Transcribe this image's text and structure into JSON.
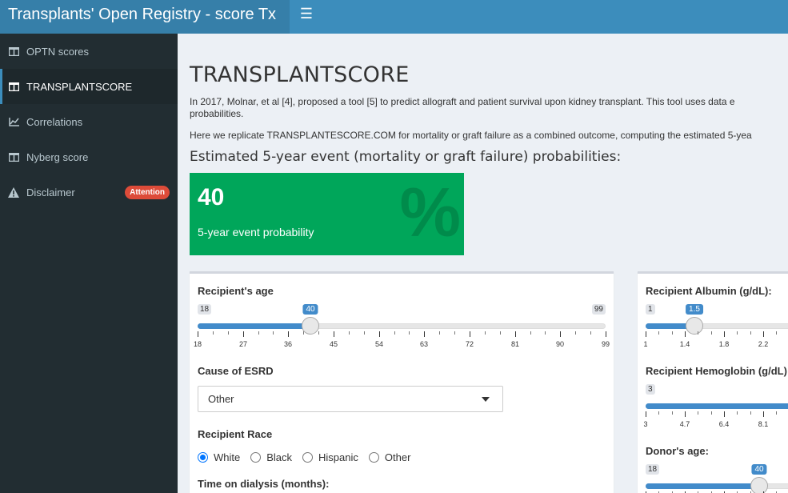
{
  "header": {
    "title": "Transplants' Open Registry - score Tx",
    "toggle_icon": "hamburger-icon"
  },
  "sidebar": {
    "items": [
      {
        "label": "OPTN scores",
        "icon": "table-icon"
      },
      {
        "label": "TRANSPLANTSCORE",
        "icon": "table-icon"
      },
      {
        "label": "Correlations",
        "icon": "line-chart-icon"
      },
      {
        "label": "Nyberg score",
        "icon": "table-icon"
      },
      {
        "label": "Disclaimer",
        "icon": "warning-icon",
        "badge": "Attention"
      }
    ],
    "active_index": 1
  },
  "main": {
    "title": "TRANSPLANTSCORE",
    "para1": "In 2017, Molnar, et al [4], proposed a tool [5] to predict allograft and patient survival upon kidney transplant. This tool uses data e",
    "para1_cont": "probabilities.",
    "para2": "Here we replicate TRANSPLANTESCORE.COM for mortality or graft failure as a combined outcome, computing the estimated 5-yea",
    "subheading": "Estimated 5-year event (mortality or graft failure) probabilities:",
    "valuebox": {
      "value": "40",
      "subtitle": "5-year event probability",
      "icon": "percent-icon",
      "color": "#00a65a"
    },
    "left_panel": {
      "age": {
        "label": "Recipient's age",
        "min": 18,
        "max": 99,
        "value": 40,
        "ticks": [
          "18",
          "27",
          "36",
          "45",
          "54",
          "63",
          "72",
          "81",
          "90",
          "99"
        ]
      },
      "esrd": {
        "label": "Cause of ESRD",
        "selected": "Other"
      },
      "race": {
        "label": "Recipient Race",
        "options": [
          "White",
          "Black",
          "Hispanic",
          "Other"
        ],
        "selected": "White"
      },
      "dialysis": {
        "label": "Time on dialysis (months):"
      }
    },
    "right_panel": {
      "albumin": {
        "label": "Recipient Albumin (g/dL):",
        "min": "1",
        "value": "1.5",
        "ticks": [
          "1",
          "1.4",
          "1.8",
          "2.2"
        ]
      },
      "hemoglobin": {
        "label": "Recipient Hemoglobin (g/dL)",
        "min": "3",
        "ticks": [
          "3",
          "4.7",
          "6.4",
          "8.1"
        ]
      },
      "donor_age": {
        "label": "Donor's age:",
        "min": "18",
        "value": "40"
      }
    }
  },
  "colors": {
    "header": "#3c8dbc",
    "logo_bg": "#367fa9",
    "sidebar": "#222d32",
    "accent": "#428bca",
    "badge": "#dd4b39"
  }
}
